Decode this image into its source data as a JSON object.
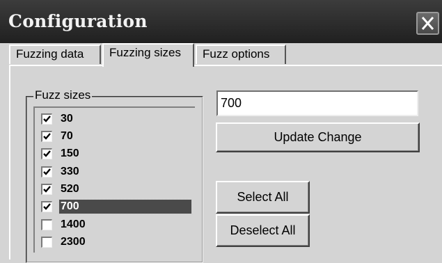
{
  "window": {
    "title": "Configuration"
  },
  "tabs": [
    {
      "label": "Fuzzing data",
      "active": false
    },
    {
      "label": "Fuzzing sizes",
      "active": true
    },
    {
      "label": "Fuzz options",
      "active": false
    }
  ],
  "fuzz_sizes": {
    "legend": "Fuzz sizes",
    "items": [
      {
        "label": "30",
        "checked": true,
        "selected": false
      },
      {
        "label": "70",
        "checked": true,
        "selected": false
      },
      {
        "label": "150",
        "checked": true,
        "selected": false
      },
      {
        "label": "330",
        "checked": true,
        "selected": false
      },
      {
        "label": "520",
        "checked": true,
        "selected": false
      },
      {
        "label": "700",
        "checked": true,
        "selected": true
      },
      {
        "label": "1400",
        "checked": false,
        "selected": false
      },
      {
        "label": "2300",
        "checked": false,
        "selected": false
      }
    ]
  },
  "editor": {
    "value": "700",
    "update_label": "Update Change"
  },
  "selection": {
    "select_all_label": "Select All",
    "deselect_all_label": "Deselect All"
  },
  "icons": {
    "close": "close-icon",
    "checkmark": "checkmark-icon"
  }
}
